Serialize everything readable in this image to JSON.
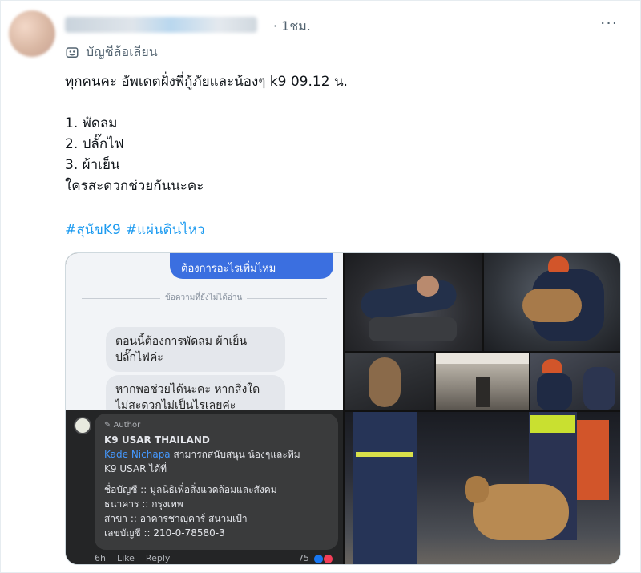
{
  "post": {
    "timestamp": "· 1ชม.",
    "more_label": "···",
    "parody_label": "บัญชีล้อเลียน",
    "text_lines": [
      "ทุกคนคะ อัพเดตฝั่งพี่กู้ภัยและน้องๆ k9 09.12 น.",
      "",
      "1. พัดลม",
      "2. ปลั๊กไฟ",
      "3. ผ้าเย็น",
      " ใครสะดวกช่วยกันนะคะ"
    ],
    "hashtags": [
      "#สุนัขK9",
      "#แผ่นดินไหว"
    ]
  },
  "media": {
    "chat": {
      "outgoing": "ต้องการอะไรเพิ่มไหม",
      "divider": "ข้อความที่ยังไม่ได้อ่าน",
      "incoming_1": [
        "ตอนนี้ต้องการพัดลม ผ้าเย็น",
        "ปลั๊กไฟค่ะ"
      ],
      "incoming_2": [
        "หากพอช่วยได้นะคะ หากสิ่งใด",
        "ไม่สะดวกไม่เป็นไรเลยค่ะ"
      ]
    },
    "fb": {
      "author_tag": "Author",
      "name": "K9 USAR THAILAND",
      "mention": "Kade Nichapa",
      "line1_rest": " สามารถสนับสนุน น้องๆและทีม",
      "line2": "K9 USAR ได้ที่",
      "account_name": "ชื่อบัญชี :: มูลนิธิเพื่อสิ่งแวดล้อมและสังคม",
      "bank": "ธนาคาร :: กรุงเทพ",
      "branch": "สาขา :: อาคารชาญุคาร์ สนามเป้า",
      "account_no": "เลขบัญชี :: 210-0-78580-3",
      "actions": [
        "6h",
        "Like",
        "Reply"
      ],
      "reaction_count": "75"
    }
  },
  "colors": {
    "link": "#1d9bf0",
    "muted": "#536471",
    "text": "#0f1419",
    "fb_bg": "#242526",
    "fb_card": "#3a3b3c",
    "fb_mention": "#4599ff"
  }
}
